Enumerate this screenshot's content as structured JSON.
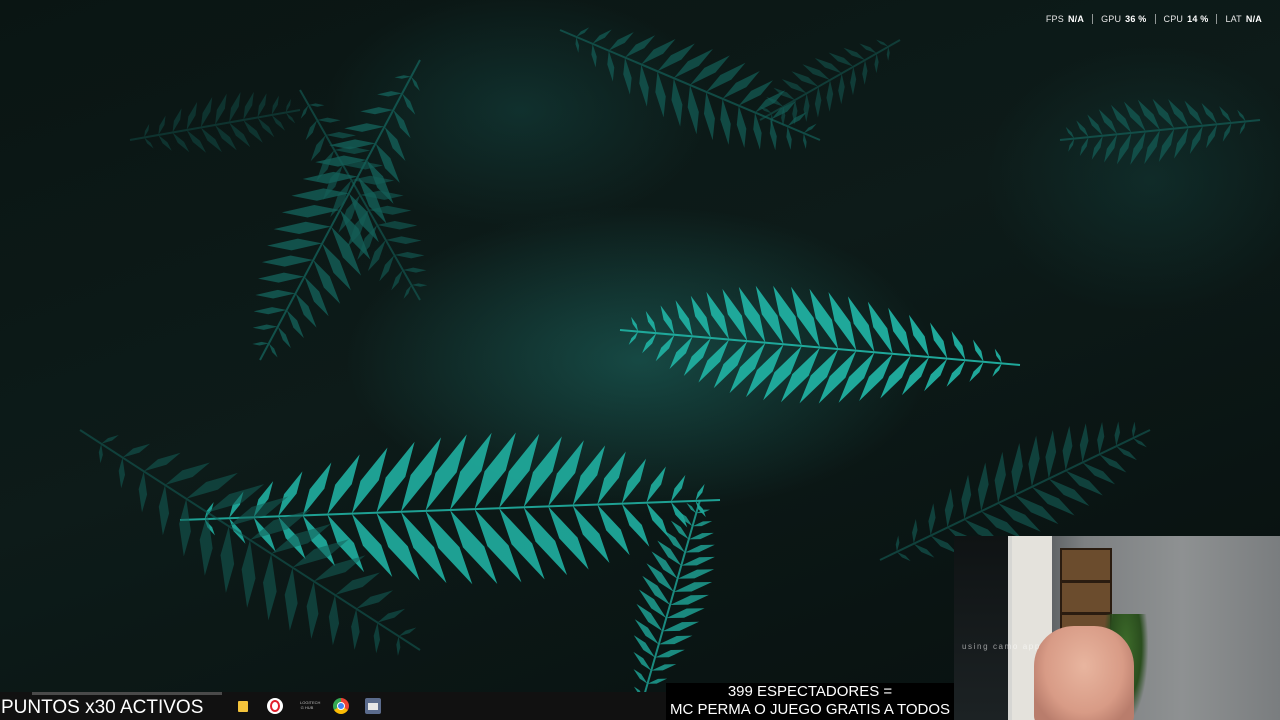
{
  "performance_overlay": {
    "metrics": [
      {
        "label": "FPS",
        "value": "N/A"
      },
      {
        "label": "GPU",
        "value": "36 %"
      },
      {
        "label": "CPU",
        "value": "14 %"
      },
      {
        "label": "LAT",
        "value": "N/A"
      }
    ]
  },
  "taskbar": {
    "points_text": "PUNTOS x30 ACTIVOS",
    "pinned_icons": [
      "file-explorer-icon",
      "opera-icon",
      "logitech-icon",
      "chrome-icon",
      "store-icon"
    ],
    "logitech_label": "LOGITECH G HUB"
  },
  "banner": {
    "line1": "399 ESPECTADORES =",
    "line2": "MC PERMA O JUEGO GRATIS A TODOS"
  },
  "webcam": {
    "watermark": "using camo app"
  },
  "colors": {
    "fern": "#1fa89a",
    "fern_dark": "#145f58",
    "background": "#0b1412",
    "banner_bg": "#000000"
  }
}
